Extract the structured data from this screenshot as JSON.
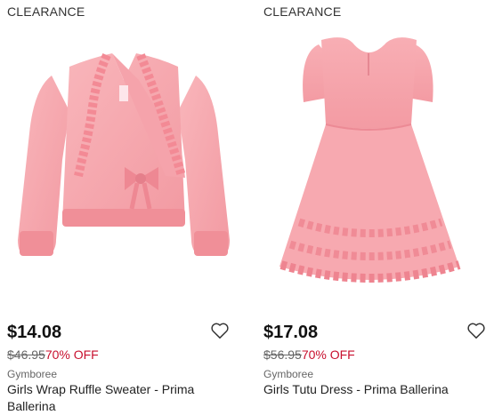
{
  "products": [
    {
      "badge": "CLEARANCE",
      "image_alt": "Pink ruffle wrap sweater",
      "price": "$14.08",
      "original_price": "$46.95",
      "discount": "70% OFF",
      "brand": "Gymboree",
      "title": "Girls Wrap Ruffle Sweater - Prima Ballerina",
      "favorite_icon": "heart-outline-icon"
    },
    {
      "badge": "CLEARANCE",
      "image_alt": "Pink tutu dress",
      "price": "$17.08",
      "original_price": "$56.95",
      "discount": "70% OFF",
      "brand": "Gymboree",
      "title": "Girls Tutu Dress - Prima Ballerina",
      "favorite_icon": "heart-outline-icon"
    }
  ],
  "colors": {
    "garment_pink": "#f7a7ad",
    "discount_red": "#c8102e"
  }
}
